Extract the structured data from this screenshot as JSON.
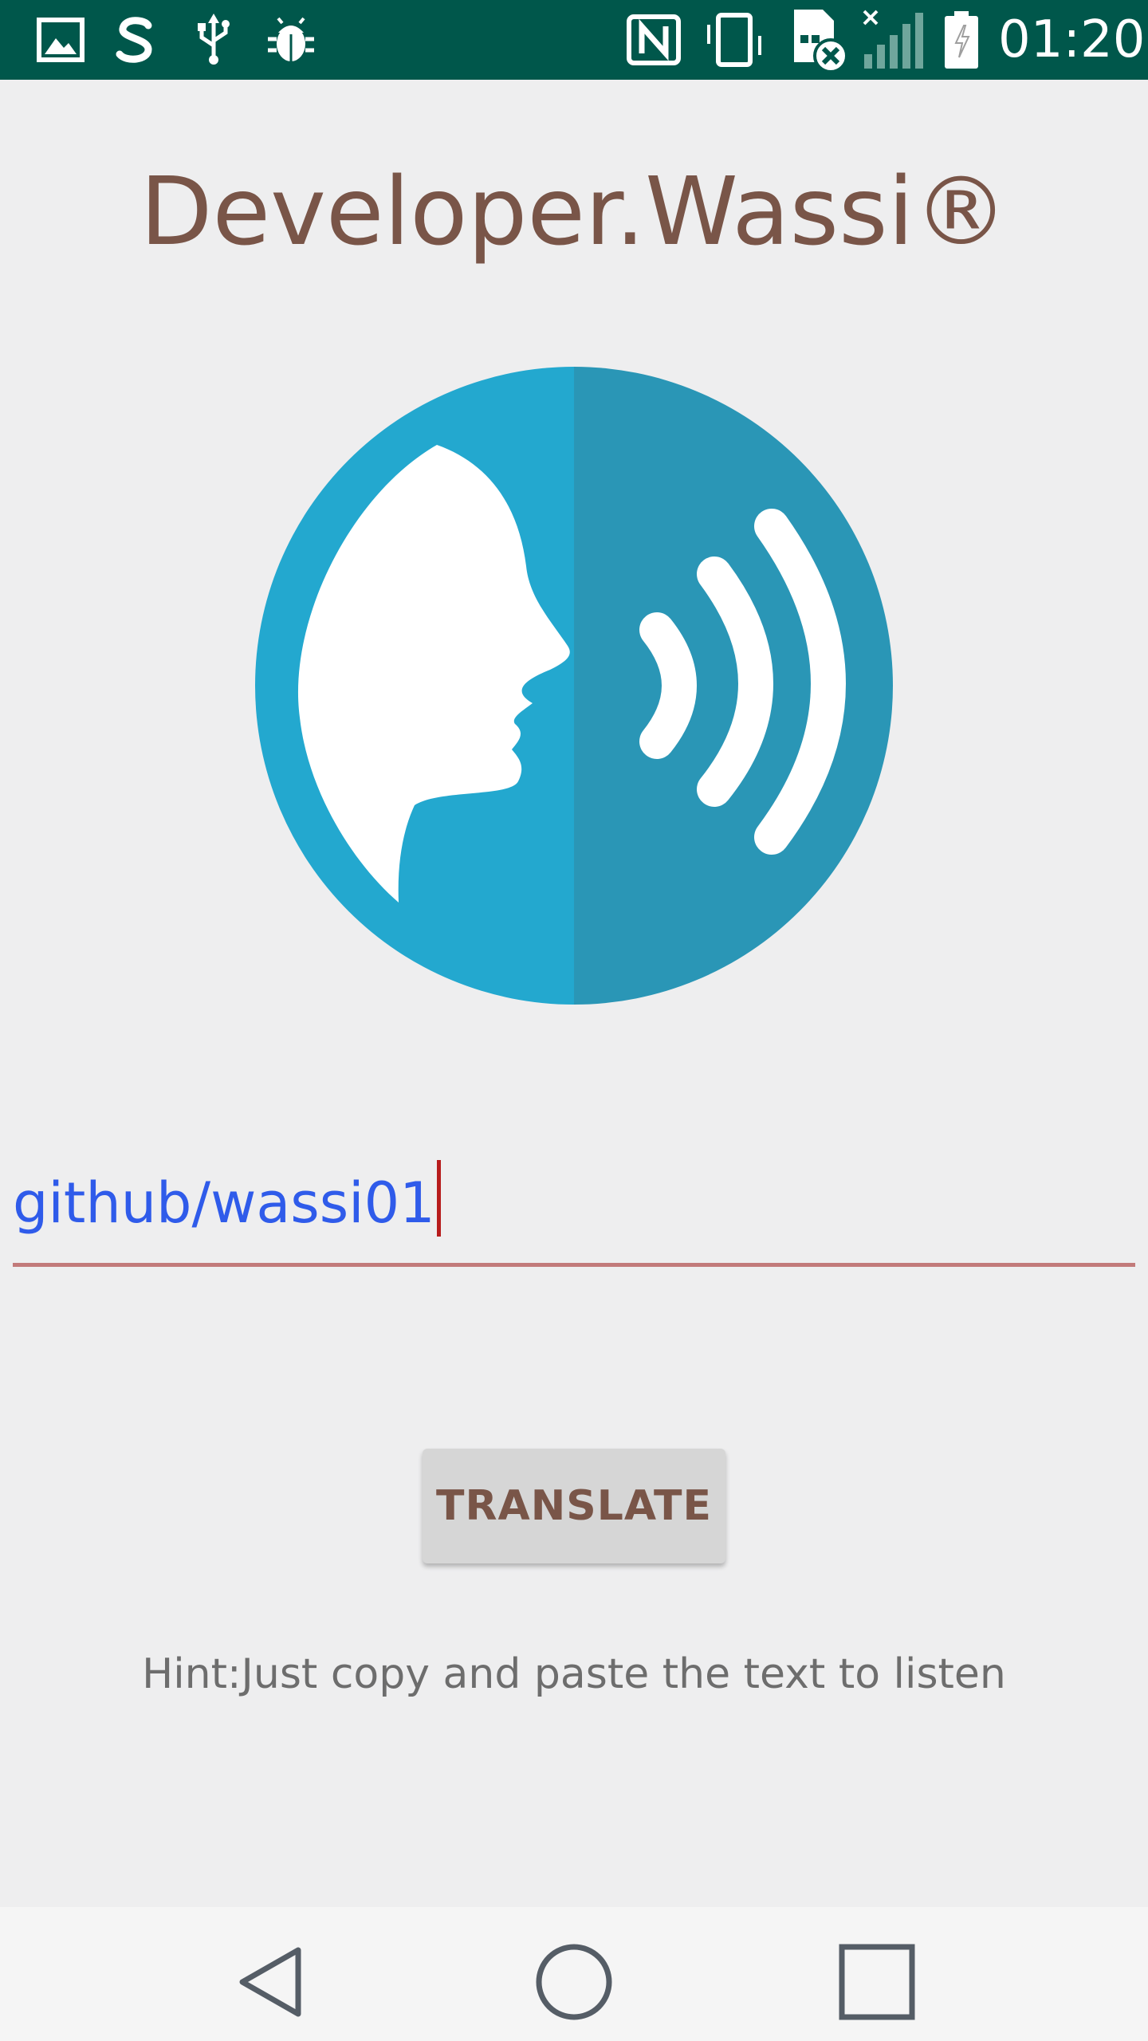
{
  "status_bar": {
    "time": "01:20",
    "left_icons": [
      "image-icon",
      "s-app-icon",
      "usb-icon",
      "debug-bug-icon"
    ],
    "right_icons": [
      "nfc-icon",
      "vibrate-icon",
      "no-sim-icon",
      "signal-no-service-icon",
      "battery-icon"
    ]
  },
  "app": {
    "title": "Developer.Wassi®",
    "logo": {
      "icon": "speaking-head-icon",
      "colors": {
        "left": "#23a8cf",
        "right": "#2a96b6",
        "foreground": "#ffffff"
      }
    }
  },
  "input": {
    "value": "github/wassi01",
    "text_color": "#2f5bea",
    "underline_color": "#c27a7a"
  },
  "translate_button": {
    "label": "TRANSLATE",
    "text_color": "#795548"
  },
  "hint": {
    "text": "Hint:Just copy and paste the text to listen"
  },
  "nav_bar": {
    "buttons": [
      "back-icon",
      "home-icon",
      "recents-icon"
    ]
  },
  "colors": {
    "status_bar": "#00574b",
    "background": "#eeeeef",
    "title": "#795548"
  }
}
